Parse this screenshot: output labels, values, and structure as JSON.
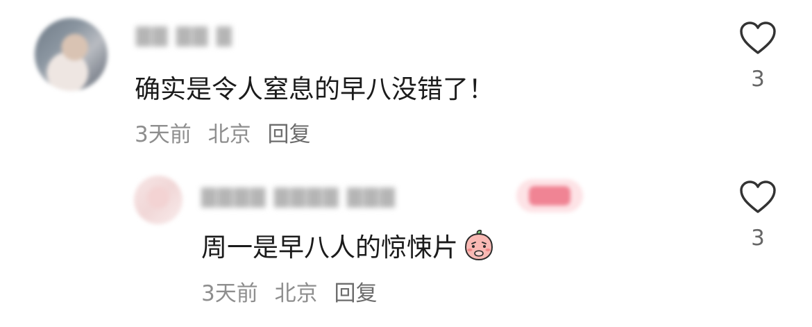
{
  "comments": [
    {
      "username": "▇▇ ▇▇ ▇",
      "text": "确实是令人窒息的早八没错了！",
      "time": "3天前",
      "location": "北京",
      "reply_label": "回复",
      "likes": "3"
    }
  ],
  "reply": {
    "username": "▇▇▇▇  ▇▇▇▇ ▇▇▇",
    "text": "周一是早八人的惊悚片",
    "emoji": "peach-covering-mouth-emoji",
    "time": "3天前",
    "location": "北京",
    "reply_label": "回复",
    "likes": "3"
  },
  "colors": {
    "text": "#1b1b1b",
    "meta": "#8e8e8e",
    "heart_stroke": "#333333",
    "tag_bg": "#fde3e6"
  }
}
